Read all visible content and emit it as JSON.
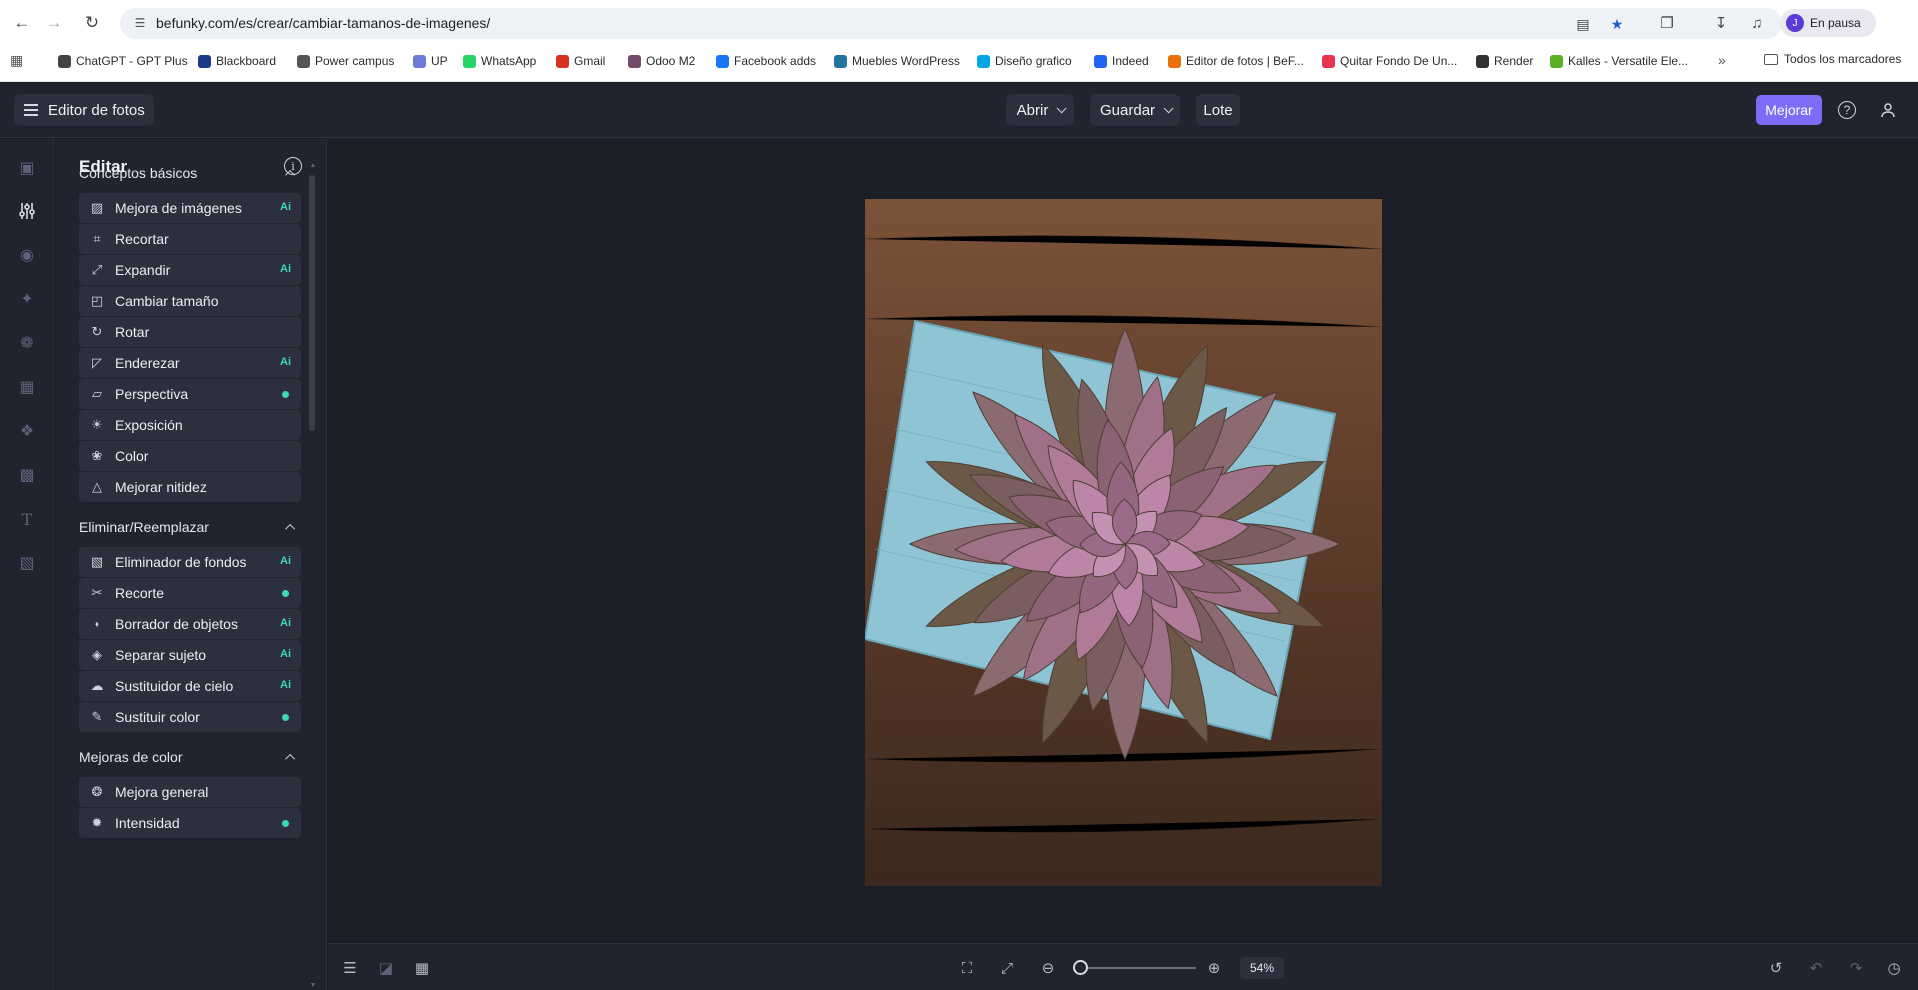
{
  "browser": {
    "url": "befunky.com/es/crear/cambiar-tamanos-de-imagenes/",
    "profile_initial": "J",
    "profile_status": "En pausa",
    "bookmarks": [
      {
        "label": "ChatGPT - GPT Plus",
        "color": "#444444"
      },
      {
        "label": "Blackboard",
        "color": "#1b3a8a"
      },
      {
        "label": "Power campus",
        "color": "#555555"
      },
      {
        "label": "UP",
        "color": "#6b7bd6"
      },
      {
        "label": "WhatsApp",
        "color": "#25d366"
      },
      {
        "label": "Gmail",
        "color": "#d93025"
      },
      {
        "label": "Odoo M2",
        "color": "#714b67"
      },
      {
        "label": "Facebook adds",
        "color": "#1877f2"
      },
      {
        "label": "Muebles WordPress",
        "color": "#21759b"
      },
      {
        "label": "Diseño grafico",
        "color": "#00a7e1"
      },
      {
        "label": "Indeed",
        "color": "#2164f3"
      },
      {
        "label": "Editor de fotos | BeF...",
        "color": "#e8710a"
      },
      {
        "label": "Quitar Fondo De Un...",
        "color": "#e8344e"
      },
      {
        "label": "Render",
        "color": "#333333"
      },
      {
        "label": "Kalles - Versatile Ele...",
        "color": "#5ab024"
      }
    ],
    "all_bookmarks": "Todos los marcadores"
  },
  "header": {
    "brand": "Editor de fotos",
    "open": "Abrir",
    "save": "Guardar",
    "batch": "Lote",
    "upgrade": "Mejorar",
    "help": "?"
  },
  "panel": {
    "title": "Editar",
    "sections": [
      {
        "title": "Conceptos básicos",
        "items": [
          {
            "label": "Mejora de imágenes",
            "badge": "ai",
            "icon": "image-enhance-icon"
          },
          {
            "label": "Recortar",
            "badge": "",
            "icon": "crop-icon"
          },
          {
            "label": "Expandir",
            "badge": "ai",
            "icon": "expand-icon"
          },
          {
            "label": "Cambiar tamaño",
            "badge": "",
            "icon": "resize-icon"
          },
          {
            "label": "Rotar",
            "badge": "",
            "icon": "rotate-icon"
          },
          {
            "label": "Enderezar",
            "badge": "ai",
            "icon": "straighten-icon"
          },
          {
            "label": "Perspectiva",
            "badge": "dot",
            "icon": "perspective-icon"
          },
          {
            "label": "Exposición",
            "badge": "",
            "icon": "exposure-icon"
          },
          {
            "label": "Color",
            "badge": "",
            "icon": "palette-icon"
          },
          {
            "label": "Mejorar nitidez",
            "badge": "",
            "icon": "sharpen-icon"
          }
        ]
      },
      {
        "title": "Eliminar/Reemplazar",
        "items": [
          {
            "label": "Eliminador de fondos",
            "badge": "ai",
            "icon": "background-remover-icon"
          },
          {
            "label": "Recorte",
            "badge": "dot",
            "icon": "cutout-icon"
          },
          {
            "label": "Borrador de objetos",
            "badge": "ai",
            "icon": "object-eraser-icon"
          },
          {
            "label": "Separar sujeto",
            "badge": "ai",
            "icon": "separate-subject-icon"
          },
          {
            "label": "Sustituidor de cielo",
            "badge": "ai",
            "icon": "sky-replace-icon"
          },
          {
            "label": "Sustituir color",
            "badge": "dot",
            "icon": "replace-color-icon"
          }
        ]
      },
      {
        "title": "Mejoras de color",
        "items": [
          {
            "label": "Mejora general",
            "badge": "",
            "icon": "general-enhance-icon"
          },
          {
            "label": "Intensidad",
            "badge": "dot",
            "icon": "intensity-icon"
          }
        ]
      }
    ],
    "ai_label": "Ai"
  },
  "bottom": {
    "zoom": "54%",
    "zoom_level": 0.05
  },
  "colors": {
    "accent": "#7c6cf8",
    "ai_badge": "#3fd7b5",
    "panel_bg": "#21232f",
    "canvas_bg": "#1b1d27"
  }
}
